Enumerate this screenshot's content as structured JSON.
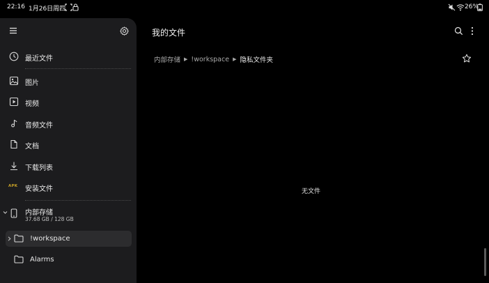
{
  "status_bar": {
    "time": "22:16",
    "date": "1月26日周四",
    "battery": "26%",
    "icons": [
      "focus-icon",
      "lock-icon",
      "mute-icon",
      "wifi-icon",
      "battery-icon"
    ]
  },
  "sidebar": {
    "items": [
      {
        "label": "最近文件",
        "icon": "clock-icon"
      },
      {
        "label": "图片",
        "icon": "image-icon"
      },
      {
        "label": "视频",
        "icon": "video-icon"
      },
      {
        "label": "音频文件",
        "icon": "music-icon"
      },
      {
        "label": "文档",
        "icon": "document-icon"
      },
      {
        "label": "下载列表",
        "icon": "download-icon"
      },
      {
        "label": "安装文件",
        "icon": "apk-icon",
        "icon_text": "APK"
      }
    ],
    "storage": {
      "label": "内部存储",
      "capacity": "37.68 GB / 128 GB"
    },
    "folders": [
      {
        "label": "!workspace",
        "selected": true
      },
      {
        "label": "Alarms",
        "selected": false
      }
    ]
  },
  "main": {
    "title": "我的文件",
    "breadcrumb": [
      "内部存储",
      "!workspace",
      "隐私文件夹"
    ],
    "empty_text": "无文件"
  },
  "colors": {
    "background": "#000000",
    "sidebar": "#1c1c1e",
    "selected_row": "#2c2c2e",
    "apk_badge": "#c9a227"
  }
}
